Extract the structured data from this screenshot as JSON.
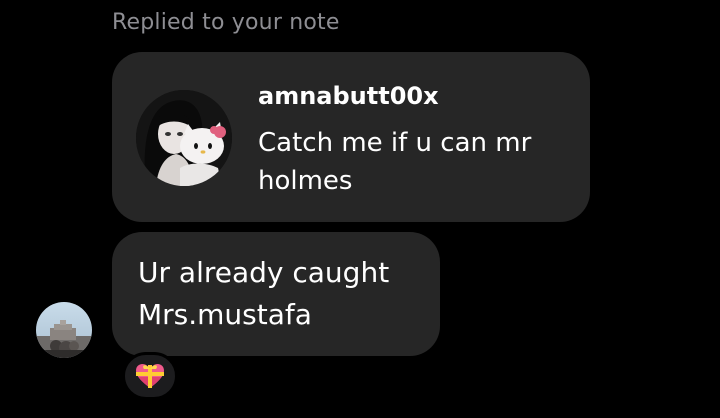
{
  "reply_caption": "Replied to your note",
  "note": {
    "username": "amnabutt00x",
    "text": "Catch me if u can mr holmes"
  },
  "message": {
    "text": "Ur already caught Mrs.mustafa"
  },
  "reaction": {
    "icon": "heart-gift-icon"
  },
  "colors": {
    "background": "#000000",
    "bubble": "#262626",
    "caption": "#8e8e93",
    "text": "#ffffff"
  }
}
